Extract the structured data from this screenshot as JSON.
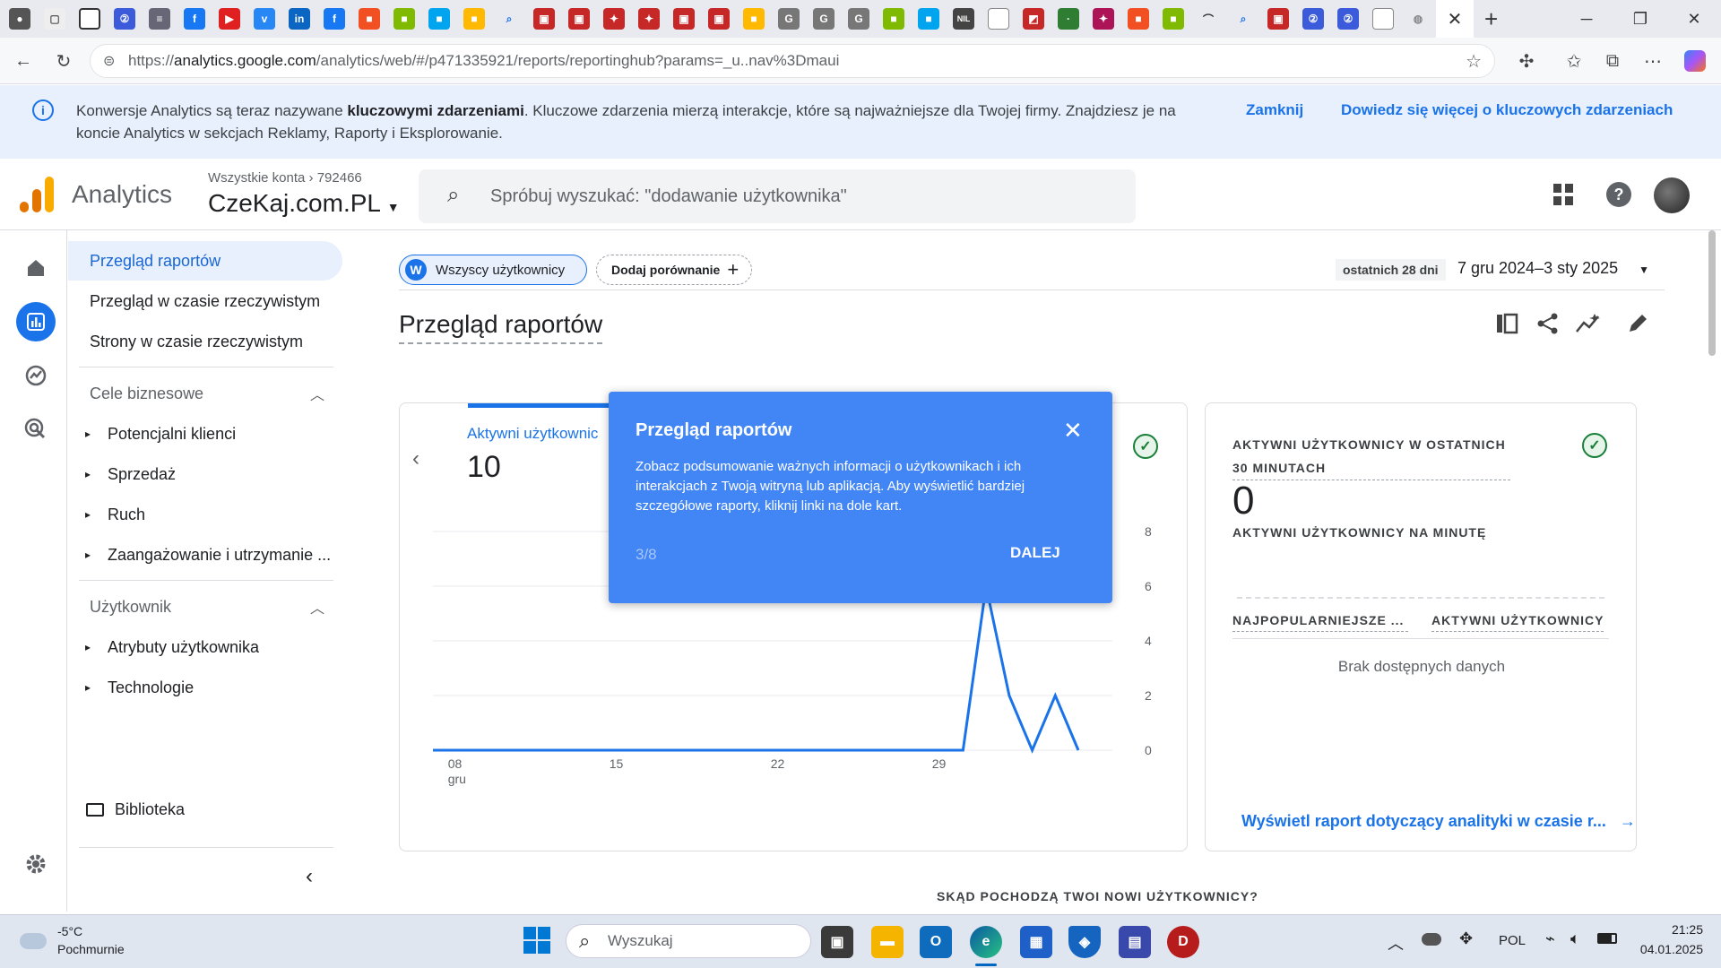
{
  "browser": {
    "url_prefix": "https://",
    "url_host": "analytics.google.com",
    "url_path": "/analytics/web/#/p471335921/reports/reportinghub?params=_u..nav%3Dmaui"
  },
  "banner": {
    "text_a": "Konwersje Analytics są teraz nazywane ",
    "text_bold": "kluczowymi zdarzeniami",
    "text_b": ". Kluczowe zdarzenia mierzą interakcje, które są najważniejsze dla Twojej firmy. Znajdziesz je na koncie Analytics w sekcjach Reklamy, Raporty i Eksplorowanie.",
    "close_label": "Zamknij",
    "learn_label": "Dowiedz się więcej o kluczowych zdarzeniach"
  },
  "header": {
    "product": "Analytics",
    "breadcrumb_all": "Wszystkie konta",
    "breadcrumb_id": "792466",
    "property": "CzeKaj.com.PL",
    "search_placeholder": "Spróbuj wyszukać: \"dodawanie użytkownika\""
  },
  "nav": {
    "items": [
      {
        "label": "Przegląd raportów"
      },
      {
        "label": "Przegląd w czasie rzeczywistym"
      },
      {
        "label": "Strony w czasie rzeczywistym"
      }
    ],
    "section1": "Cele biznesowe",
    "section1_items": [
      "Potencjalni klienci",
      "Sprzedaż",
      "Ruch",
      "Zaangażowanie i utrzymanie ..."
    ],
    "section2": "Użytkownik",
    "section2_items": [
      "Atrybuty użytkownika",
      "Technologie"
    ],
    "library": "Biblioteka"
  },
  "toolbar": {
    "segment_letter": "W",
    "segment_label": "Wszyscy użytkownicy",
    "compare_label": "Dodaj porównanie",
    "date_prefix": "ostatnich 28 dni",
    "date_range": "7 gru 2024–3 sty 2025"
  },
  "page": {
    "title": "Przegląd raportów",
    "bottom_heading": "SKĄD POCHODZĄ TWOI NOWI UŻYTKOWNICY?"
  },
  "card1": {
    "metric_label": "Aktywni użytkownic",
    "metric_value": "10"
  },
  "chart_data": {
    "type": "line",
    "x_ticks": [
      "08",
      "15",
      "22",
      "29"
    ],
    "x_sub": "gru",
    "y_ticks": [
      "0",
      "2",
      "4",
      "6",
      "8"
    ],
    "ylim": [
      0,
      8
    ],
    "series": [
      {
        "values": [
          0,
          0,
          0,
          0,
          0,
          0,
          0,
          0,
          0,
          0,
          0,
          0,
          0,
          0,
          0,
          0,
          0,
          0,
          0,
          0,
          0,
          0,
          0,
          0,
          6,
          2,
          0,
          2,
          0
        ]
      }
    ],
    "line_color": "#1a73e8"
  },
  "card2": {
    "title": "AKTYWNI UŻYTKOWNICY W OSTATNICH 30 MINUTACH",
    "value": "0",
    "per_minute": "AKTYWNI UŻYTKOWNICY NA MINUTĘ",
    "col1": "NAJPOPULARNIEJSZE ...",
    "col2": "AKTYWNI UŻYTKOWNICY",
    "empty": "Brak dostępnych danych",
    "link": "Wyświetl raport dotyczący analityki w czasie r..."
  },
  "modal": {
    "title": "Przegląd raportów",
    "body": "Zobacz podsumowanie ważnych informacji o użytkownikach i ich interakcjach z Twoją witryną lub aplikacją. Aby wyświetlić bardziej szczegółowe raporty, kliknij linki na dole kart.",
    "step": "3/8",
    "next": "DALEJ"
  },
  "taskbar": {
    "temp": "-5°C",
    "weather": "Pochmurnie",
    "search": "Wyszukaj",
    "lang": "POL",
    "time": "21:25",
    "date": "04.01.2025"
  }
}
